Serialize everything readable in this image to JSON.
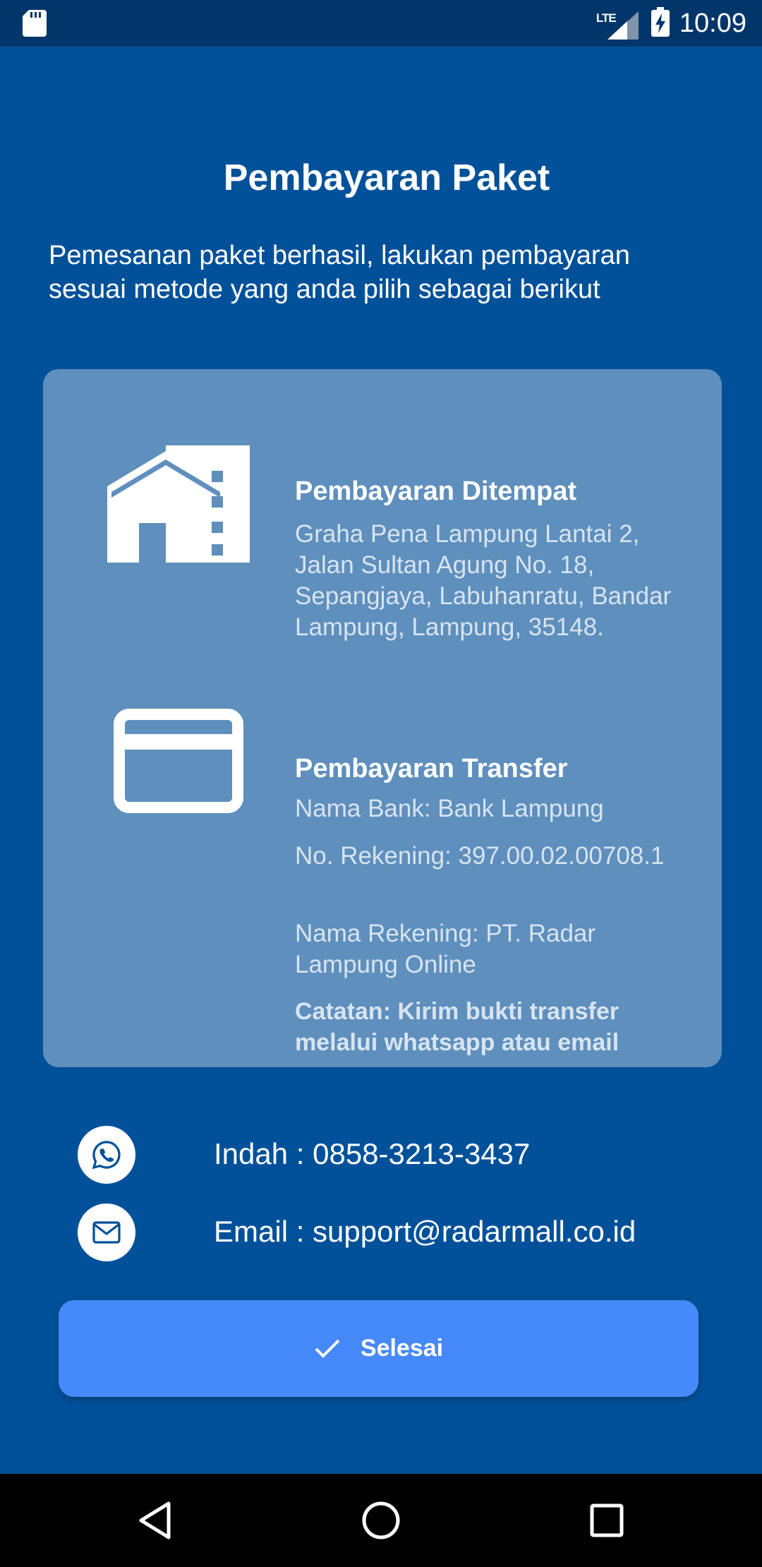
{
  "status_bar": {
    "network": "LTE",
    "time": "10:09"
  },
  "page": {
    "title": "Pembayaran Paket",
    "intro": "Pemesanan paket berhasil, lakukan pembayaran sesuai metode yang anda pilih sebagai berikut"
  },
  "onsite": {
    "icon": "building-icon",
    "title": "Pembayaran Ditempat",
    "address": "Graha Pena Lampung Lantai 2, Jalan Sultan Agung No. 18, Sepangjaya, Labuhanratu, Bandar Lampung, Lampung, 35148."
  },
  "transfer": {
    "icon": "credit-card-icon",
    "title": "Pembayaran Transfer",
    "bank": "Nama Bank: Bank Lampung",
    "account_number": "No. Rekening: 397.00.02.00708.1",
    "account_name": "Nama Rekening: PT. Radar Lampung Online",
    "note": "Catatan: Kirim bukti transfer melalui whatsapp atau email"
  },
  "contacts": {
    "whatsapp": "Indah : 0858-3213-3437",
    "email": "Email : support@radarmall.co.id"
  },
  "done_button": {
    "label": "Selesai"
  },
  "colors": {
    "background": "#01519a",
    "status_bar": "#02366b",
    "card": "#5e8fbd",
    "button": "#4589fa"
  }
}
